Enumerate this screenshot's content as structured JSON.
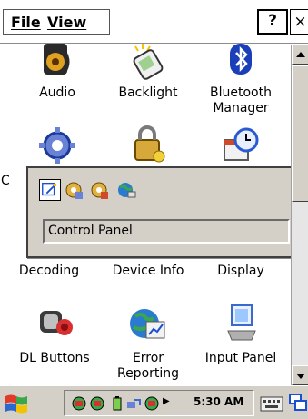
{
  "menubar": {
    "file_label": "File",
    "view_label": "View",
    "help_label": "?",
    "close_label": "×"
  },
  "items": [
    {
      "label": "Audio",
      "label2": "",
      "icon": "audio-icon"
    },
    {
      "label": "Backlight",
      "label2": "",
      "icon": "backlight-icon"
    },
    {
      "label": "Bluetooth",
      "label2": "Manager",
      "icon": "bluetooth-icon"
    },
    {
      "label": "C",
      "label2": "",
      "icon": "certificates-icon"
    },
    {
      "label": "",
      "label2": "",
      "icon": "security-icon"
    },
    {
      "label": "",
      "label2": "",
      "icon": "date-time-icon"
    },
    {
      "label": "Decoding",
      "label2": "",
      "icon": "decoding-icon"
    },
    {
      "label": "Device Info",
      "label2": "",
      "icon": "device-info-icon"
    },
    {
      "label": "Display",
      "label2": "",
      "icon": "display-icon"
    },
    {
      "label": "DL Buttons",
      "label2": "",
      "icon": "dl-buttons-icon"
    },
    {
      "label": "Error",
      "label2": "Reporting",
      "icon": "error-reporting-icon"
    },
    {
      "label": "Input Panel",
      "label2": "",
      "icon": "input-panel-icon"
    }
  ],
  "popup": {
    "title": "Control Panel",
    "icons": [
      "control-panel-icon",
      "settings-icon",
      "settings-alt-icon",
      "internet-icon"
    ]
  },
  "taskbar": {
    "clock": "5:30 AM",
    "start_icon": "windows-flag-icon",
    "tray_icons": [
      "network-icon",
      "network-alt-icon",
      "battery-icon",
      "connection-icon",
      "globe-icon"
    ],
    "keyboard_icon": "keyboard-icon",
    "switch_icon": "window-switch-icon"
  },
  "colors": {
    "chrome": "#d4d0c8",
    "accent_blue": "#1a4fd1",
    "border_dark": "#404040"
  }
}
